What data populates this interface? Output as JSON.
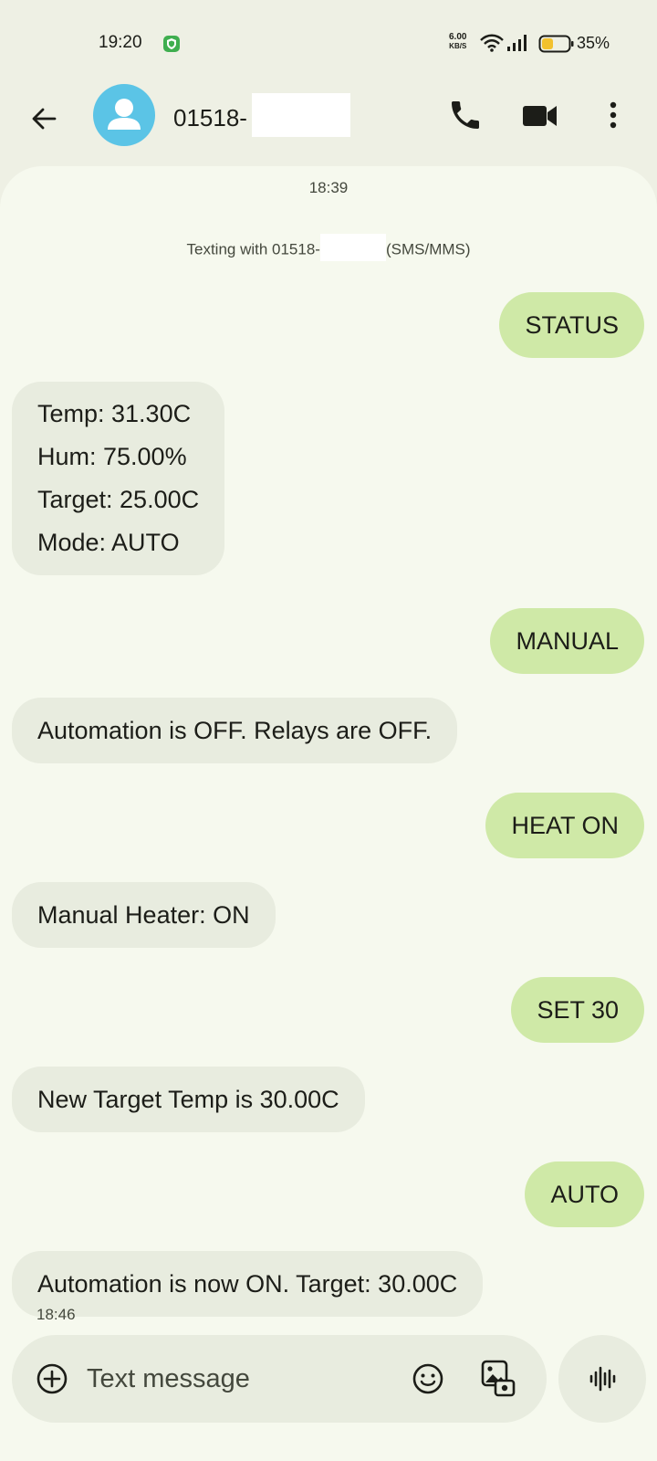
{
  "status_bar": {
    "time": "19:20",
    "net_speed_value": "6.00",
    "net_speed_unit": "KB/S",
    "battery_percent": "35%"
  },
  "header": {
    "contact_name": "01518-",
    "icons": [
      "back-arrow-icon",
      "contact-avatar-icon",
      "phone-icon",
      "video-call-icon",
      "more-vert-icon"
    ]
  },
  "conversation": {
    "top_timestamp": "18:39",
    "texting_info_prefix": "Texting with 01518-",
    "texting_info_suffix": "(SMS/MMS)",
    "messages": [
      {
        "direction": "outgoing",
        "text": "STATUS"
      },
      {
        "direction": "incoming",
        "lines": [
          "Temp: 31.30C",
          "Hum: 75.00%",
          "Target: 25.00C",
          "Mode: AUTO"
        ]
      },
      {
        "direction": "outgoing",
        "text": "MANUAL"
      },
      {
        "direction": "incoming",
        "text": "Automation is OFF. Relays are OFF."
      },
      {
        "direction": "outgoing",
        "text": "HEAT ON"
      },
      {
        "direction": "incoming",
        "text": "Manual Heater: ON"
      },
      {
        "direction": "outgoing",
        "text": "SET 30"
      },
      {
        "direction": "incoming",
        "text": "New Target Temp is 30.00C"
      },
      {
        "direction": "outgoing",
        "text": "AUTO"
      },
      {
        "direction": "incoming",
        "text": "Automation is now ON. Target: 30.00C"
      }
    ],
    "bottom_timestamp": "18:46"
  },
  "composer": {
    "placeholder": "Text message",
    "icons": [
      "add-circle-icon",
      "emoji-icon",
      "gallery-icon",
      "voice-wave-icon"
    ]
  },
  "colors": {
    "outgoing_bubble": "#cfe9a7",
    "incoming_bubble": "#e8ecdf",
    "chat_background": "#f6f9ee",
    "avatar": "#5bc4e6"
  }
}
